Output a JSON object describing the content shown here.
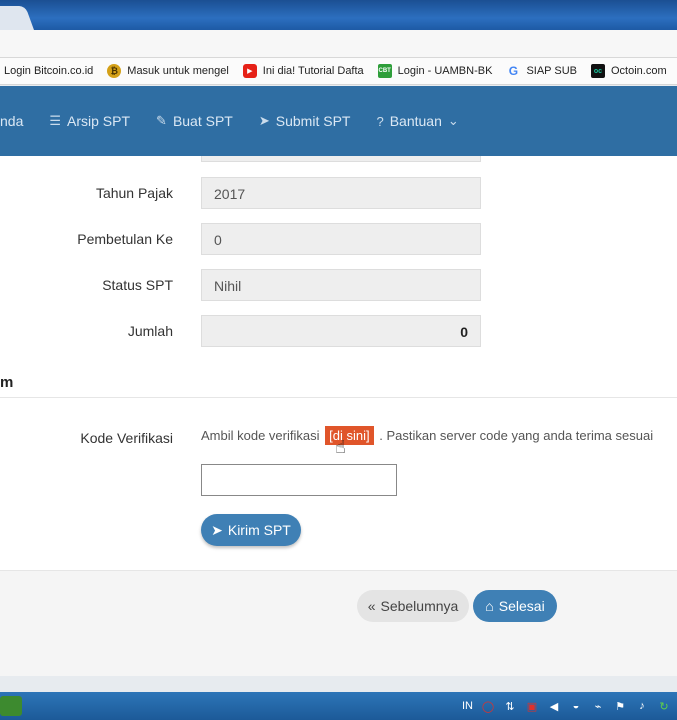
{
  "bookmarks": [
    {
      "label": "Login Bitcoin.co.id",
      "icon": "bitcoin-icon"
    },
    {
      "label": "Masuk untuk mengel",
      "icon": "coin-icon"
    },
    {
      "label": "Ini dia! Tutorial Dafta",
      "icon": "youtube-icon"
    },
    {
      "label": "Login - UAMBN-BK",
      "icon": "cbt-icon"
    },
    {
      "label": "SIAP SUB",
      "icon": "google-icon"
    },
    {
      "label": "Octoin.com",
      "icon": "octoin-icon"
    }
  ],
  "nav": {
    "item0": "nda",
    "arsip": "Arsip SPT",
    "buat": "Buat SPT",
    "submit": "Submit SPT",
    "bantuan": "Bantuan"
  },
  "form": {
    "tahun_label": "Tahun Pajak",
    "tahun_value": "2017",
    "pembetulan_label": "Pembetulan Ke",
    "pembetulan_value": "0",
    "status_label": "Status SPT",
    "status_value": "Nihil",
    "jumlah_label": "Jumlah",
    "jumlah_value": "0"
  },
  "section": {
    "title": "m",
    "verif_label": "Kode Verifikasi",
    "verif_text_before": "Ambil kode verifikasi",
    "verif_link": "[di sini]",
    "verif_text_after": ". Pastikan server code yang anda terima sesuai",
    "verif_placeholder": ""
  },
  "buttons": {
    "kirim": "Kirim SPT",
    "sebelumnya": "Sebelumnya",
    "selesai": "Selesai"
  },
  "taskbar": {
    "lang": "IN"
  },
  "colors": {
    "nav_bg": "#2f6ea3",
    "primary_button": "#3f80b5",
    "link_highlight": "#e0552a"
  }
}
